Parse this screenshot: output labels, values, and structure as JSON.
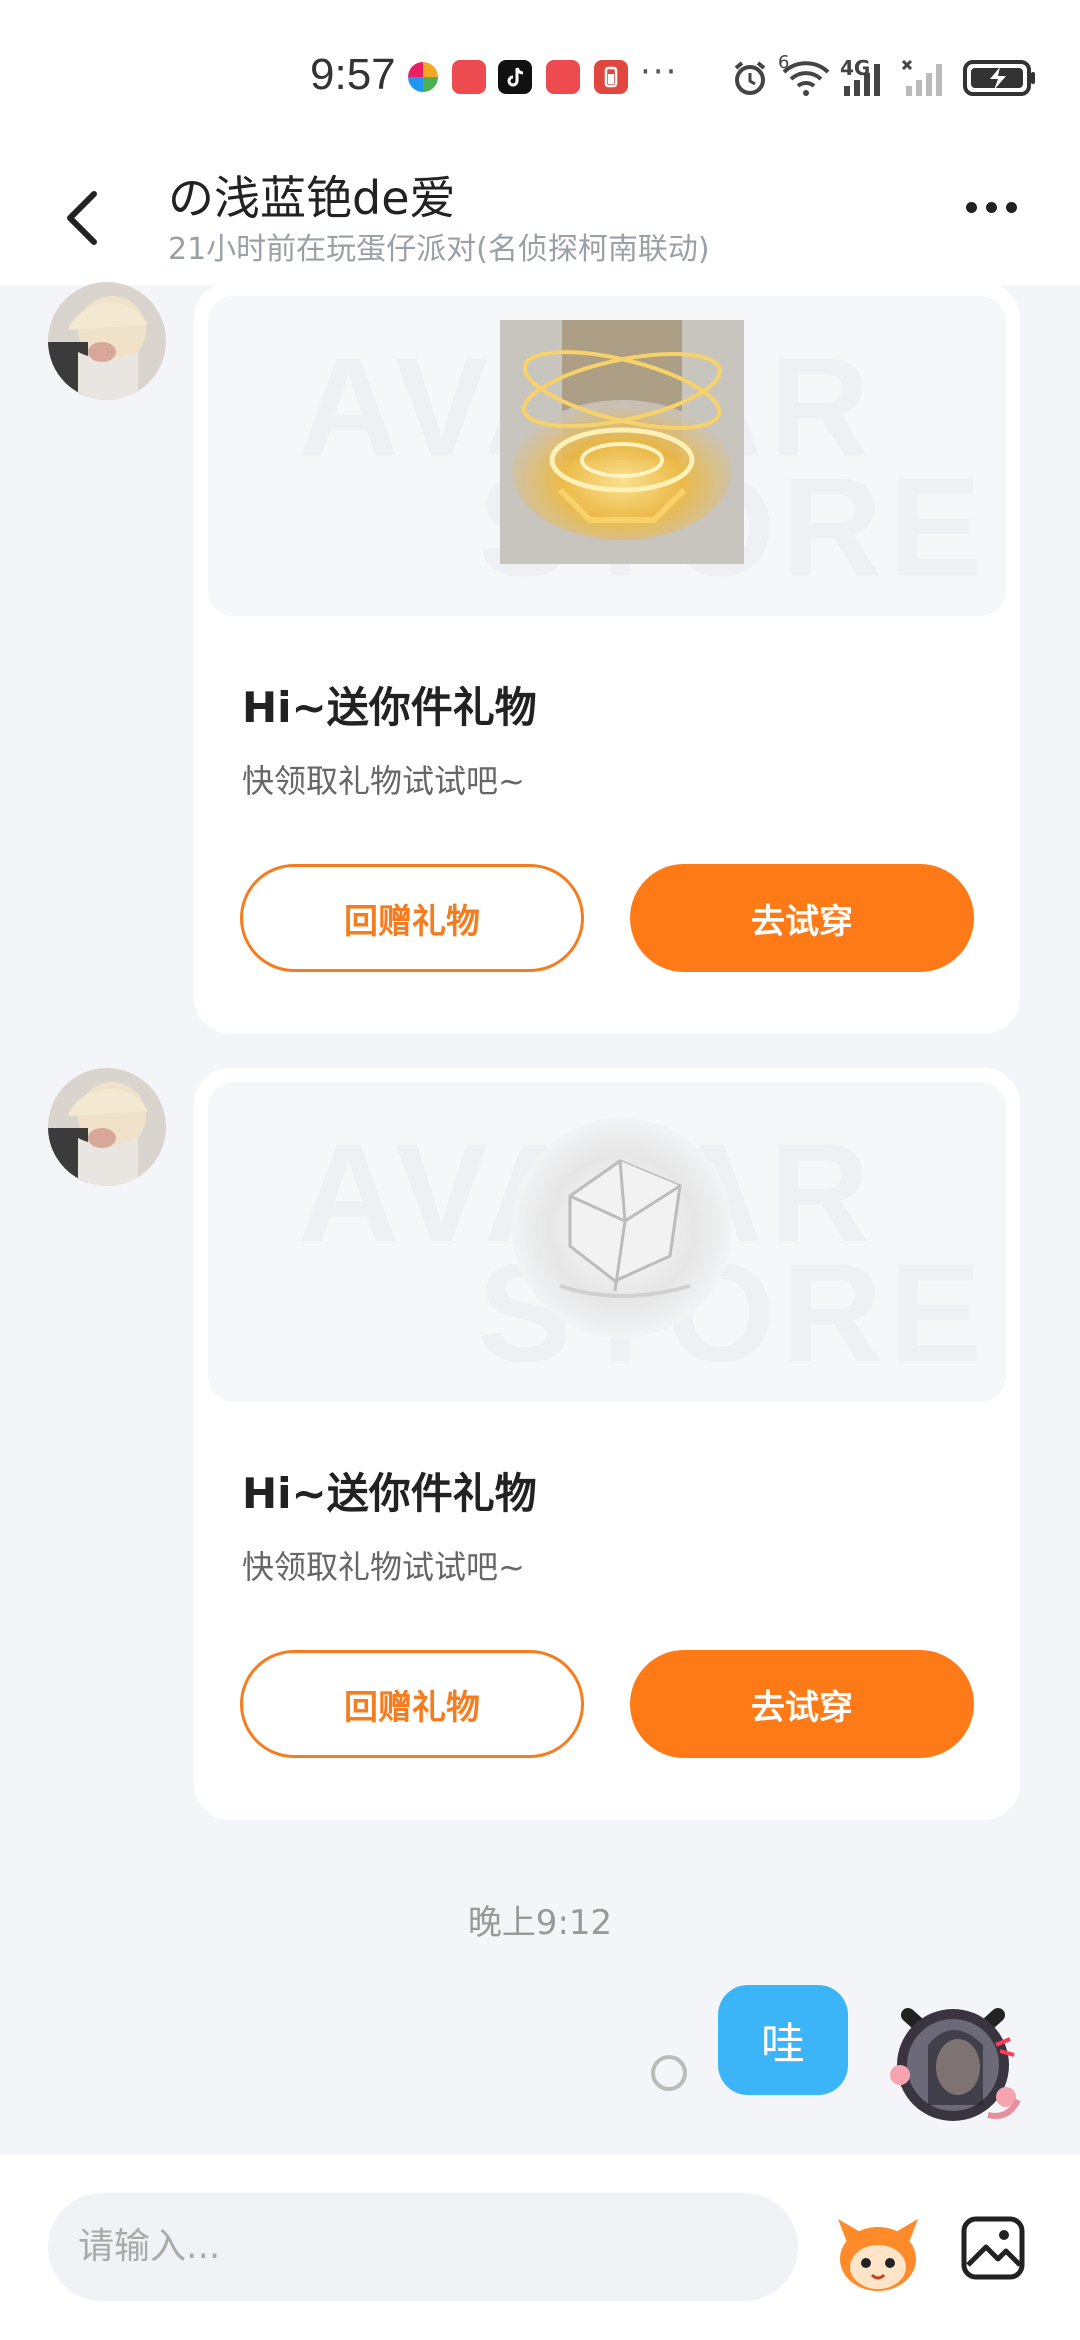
{
  "status_bar": {
    "time": "9:57",
    "dots": "···",
    "icons": [
      "browser-icon",
      "huawei-icon",
      "tiktok-icon",
      "huawei-icon",
      "battery-app-icon",
      "alarm-icon",
      "wifi-icon",
      "signal-4g-icon",
      "signal-icon",
      "battery-charging-icon"
    ],
    "wifi_badge": "6",
    "network": "4G"
  },
  "header": {
    "title": "の浅蓝铯de爱",
    "subtitle": "21小时前在玩蛋仔派对(名侦探柯南联动)"
  },
  "messages": [
    {
      "gift_title": "Hi~送你件礼物",
      "gift_subtitle": "快领取礼物试试吧~",
      "watermark_top": "AVATAR",
      "watermark_bottom": "STORE",
      "return_button": "回赠礼物",
      "try_button": "去试穿"
    },
    {
      "gift_title": "Hi~送你件礼物",
      "gift_subtitle": "快领取礼物试试吧~",
      "watermark_top": "AVATAR",
      "watermark_bottom": "STORE",
      "return_button": "回赠礼物",
      "try_button": "去试穿"
    }
  ],
  "timestamp": "晚上9:12",
  "my_message": {
    "text": "哇"
  },
  "input": {
    "placeholder": "请输入..."
  },
  "colors": {
    "accent": "#fd7a16",
    "bubble": "#3bb5f7",
    "background": "#f3f5f8"
  }
}
